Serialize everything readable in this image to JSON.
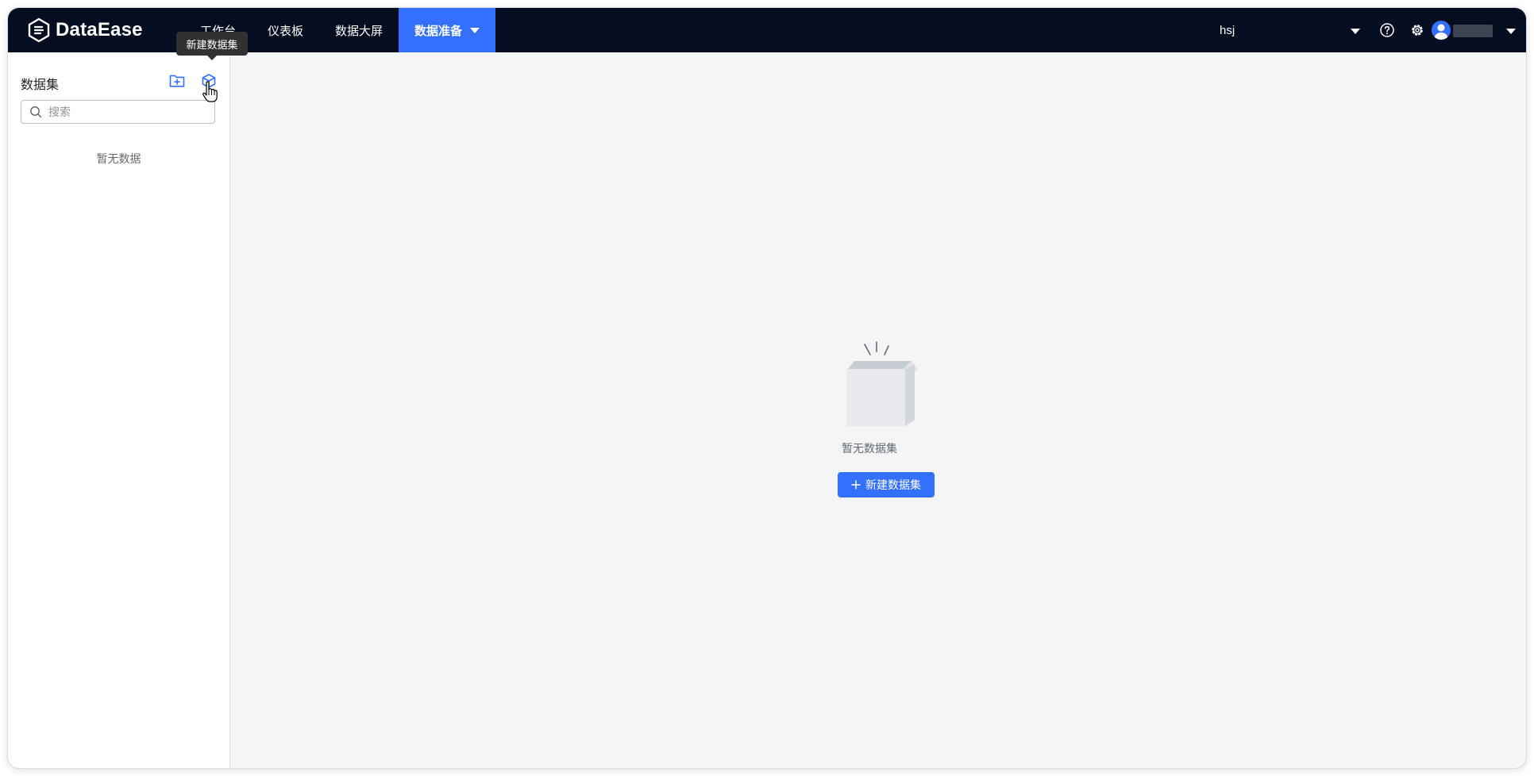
{
  "app": {
    "logo_text": "DataEase"
  },
  "nav": {
    "items": [
      {
        "label": "工作台"
      },
      {
        "label": "仪表板"
      },
      {
        "label": "数据大屏"
      },
      {
        "label": "数据准备"
      }
    ]
  },
  "header": {
    "org_name": "hsj"
  },
  "tooltip": {
    "text": "新建数据集"
  },
  "sidebar": {
    "title": "数据集",
    "search_placeholder": "搜索",
    "empty_text": "暂无数据"
  },
  "main": {
    "empty_text": "暂无数据集",
    "create_button_label": "新建数据集"
  },
  "colors": {
    "topbar": "#050e21",
    "accent": "#3370ff",
    "background": "#f4f5f7"
  }
}
